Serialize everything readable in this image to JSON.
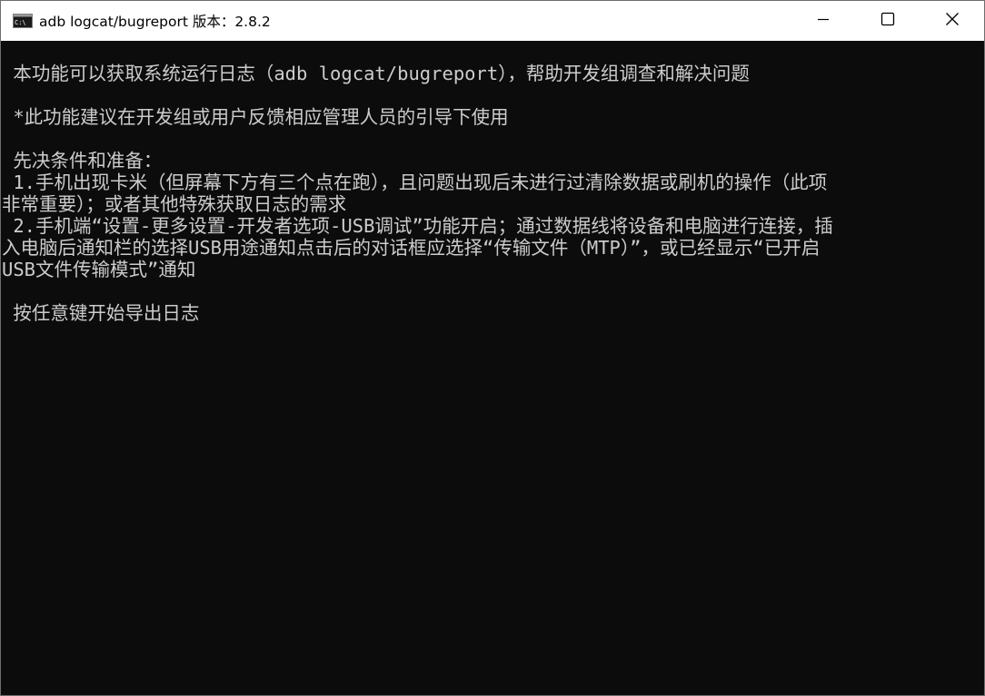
{
  "window": {
    "title": "adb logcat/bugreport 版本：2.8.2",
    "app_icon": "console-icon",
    "controls": {
      "minimize_icon": "minimize-icon",
      "maximize_icon": "maximize-icon",
      "close_icon": "close-icon"
    }
  },
  "console": {
    "lines": [
      " 本功能可以获取系统运行日志（adb logcat/bugreport），帮助开发组调查和解决问题",
      " *此功能建议在开发组或用户反馈相应管理人员的引导下使用",
      " 先决条件和准备：",
      " 1.手机出现卡米（但屏幕下方有三个点在跑），且问题出现后未进行过清除数据或刷机的操作（此项",
      "非常重要）；或者其他特殊获取日志的需求",
      " 2.手机端“设置-更多设置-开发者选项-USB调试”功能开启；通过数据线将设备和电脑进行连接，插",
      "入电脑后通知栏的选择USB用途通知点击后的对话框应选择“传输文件（MTP）”，或已经显示“已开启",
      "USB文件传输模式”通知",
      " 按任意键开始导出日志"
    ]
  },
  "colors": {
    "console_bg": "#0c0c0c",
    "console_text": "#cccccc",
    "titlebar_bg": "#ffffff"
  }
}
